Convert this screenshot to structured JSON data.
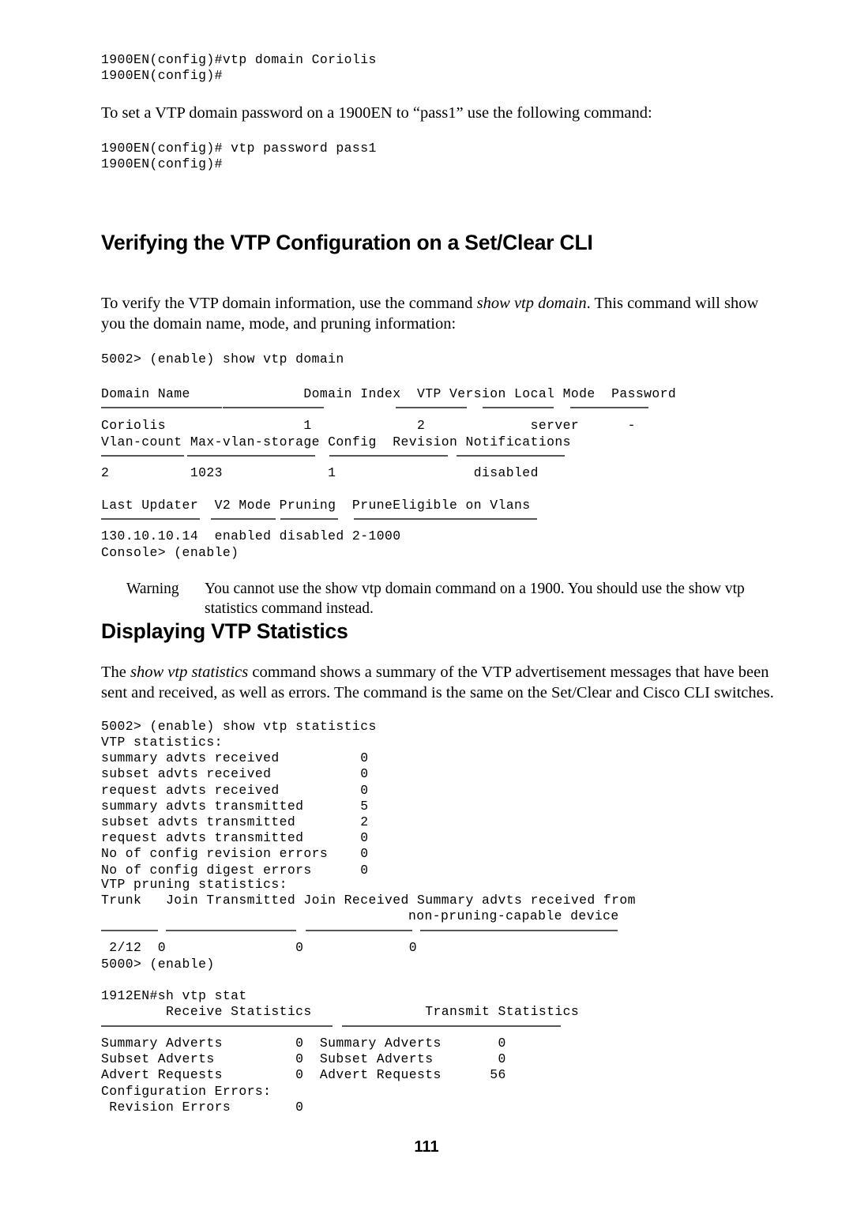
{
  "page": {
    "number": "111"
  },
  "top_code_1": "1900EN(config)#vtp domain Coriolis\n1900EN(config)#",
  "para_password_intro": "To set a VTP domain password on a 1900EN to “pass1” use the following command:",
  "top_code_2": "1900EN(config)# vtp password pass1\n1900EN(config)#",
  "heading_verifying": "Verifying the VTP Configuration on a Set/Clear CLI",
  "para_verify": {
    "part1": "To verify the VTP domain information, use the command ",
    "italic": "show vtp domain",
    "part2": ". This command will show you the domain name, mode, and pruning information:"
  },
  "vtp_domain_output": {
    "command": "5002> (enable) show vtp domain",
    "header_row_1": "Domain Name              Domain Index  VTP Version Local Mode  Password",
    "data_row_1": "Coriolis                 1             2             server      -",
    "header_row_2": "Vlan-count Max-vlan-storage Config  Revision Notifications",
    "data_row_2": "2          1023             1                 disabled",
    "header_row_3": "Last Updater  V2 Mode Pruning  PruneEligible on Vlans",
    "data_row_3": "130.10.10.14  enabled disabled 2-1000",
    "prompt": "Console> (enable)"
  },
  "warning": {
    "label": "Warning",
    "text": "You cannot use the show vtp domain command on a 1900. You should use the show vtp statistics command instead."
  },
  "heading_displaying": "Displaying VTP Statistics",
  "para_statistics": {
    "part1": "The ",
    "italic": "show vtp statistics",
    "part2": " command shows a summary of the VTP advertisement messages that have been sent and received, as well as errors. The command is the same on the Set/Clear and Cisco CLI switches."
  },
  "vtp_statistics_output": {
    "command": "5002> (enable) show vtp statistics",
    "title": "VTP statistics:",
    "rows": [
      {
        "label": "summary advts received",
        "value": "0"
      },
      {
        "label": "subset advts received",
        "value": "0"
      },
      {
        "label": "request advts received",
        "value": "0"
      },
      {
        "label": "summary advts transmitted",
        "value": "5"
      },
      {
        "label": "subset advts transmitted",
        "value": "2"
      },
      {
        "label": "request advts transmitted",
        "value": "0"
      },
      {
        "label": "No of config revision errors",
        "value": "0"
      },
      {
        "label": "No of config digest errors",
        "value": "0"
      }
    ],
    "body": "VTP statistics:\nsummary advts received          0\nsubset advts received           0\nrequest advts received          0\nsummary advts transmitted       5\nsubset advts transmitted        2\nrequest advts transmitted       0\nNo of config revision errors    0\nNo of config digest errors      0",
    "pruning_title": "VTP pruning statistics:",
    "pruning_header_line1": "Trunk   Join Transmitted Join Received Summary advts received from",
    "pruning_header_line2": "non-pruning-capable device",
    "pruning_data": " 2/12  0                0             0",
    "prompt": "5000> (enable)"
  },
  "cisco_cli_output": {
    "command": "1912EN#sh vtp stat",
    "header": "        Receive Statistics              Transmit Statistics",
    "rows": [
      {
        "rx_label": "Summary Adverts",
        "rx_value": "0",
        "tx_label": "Summary Adverts",
        "tx_value": "0"
      },
      {
        "rx_label": "Subset Adverts",
        "rx_value": "0",
        "tx_label": "Subset Adverts",
        "tx_value": "0"
      },
      {
        "rx_label": "Advert Requests",
        "rx_value": "0",
        "tx_label": "Advert Requests",
        "tx_value": "56"
      }
    ],
    "body": "Summary Adverts         0  Summary Adverts       0\nSubset Adverts          0  Subset Adverts        0\nAdvert Requests         0  Advert Requests      56\nConfiguration Errors:\n Revision Errors        0",
    "config_errors_label": "Configuration Errors:",
    "revision_errors_label": " Revision Errors",
    "revision_errors_value": "0"
  }
}
